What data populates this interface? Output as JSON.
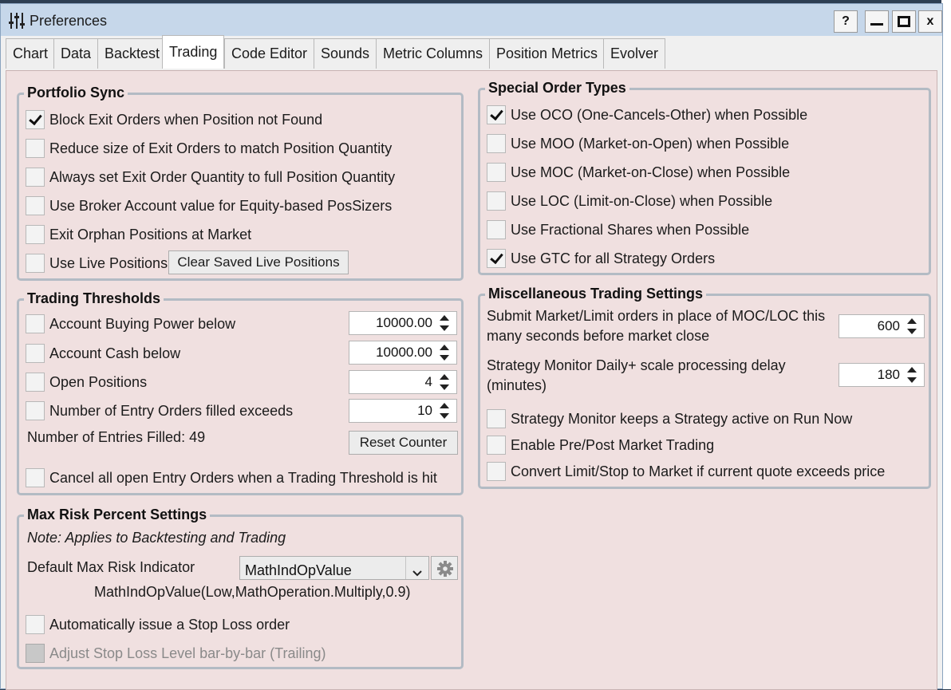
{
  "window": {
    "title": "Preferences",
    "help_label": "?",
    "minimize_label": "—",
    "maximize_label": "▣",
    "close_label": "x"
  },
  "tabs": [
    "Chart",
    "Data",
    "Backtest",
    "Trading",
    "Code Editor",
    "Sounds",
    "Metric Columns",
    "Position Metrics",
    "Evolver"
  ],
  "active_tab": "Trading",
  "portfolio_sync": {
    "title": "Portfolio Sync",
    "items": [
      {
        "label": "Block Exit Orders when Position not Found",
        "checked": true
      },
      {
        "label": "Reduce size of Exit Orders to match Position Quantity",
        "checked": false
      },
      {
        "label": "Always set Exit Order Quantity to full Position Quantity",
        "checked": false
      },
      {
        "label": "Use Broker Account value for Equity-based PosSizers",
        "checked": false
      },
      {
        "label": "Exit Orphan Positions at Market",
        "checked": false
      },
      {
        "label": "Use Live Positions",
        "checked": false
      }
    ],
    "clear_button": "Clear Saved Live Positions"
  },
  "trading_thresholds": {
    "title": "Trading Thresholds",
    "items": [
      {
        "label": "Account Buying Power below",
        "checked": false,
        "value": "10000.00"
      },
      {
        "label": "Account Cash below",
        "checked": false,
        "value": "10000.00"
      },
      {
        "label": "Open Positions",
        "checked": false,
        "value": "4"
      },
      {
        "label": "Number of Entry Orders filled exceeds",
        "checked": false,
        "value": "10"
      }
    ],
    "entries_filled": "Number of Entries Filled: 49",
    "reset_button": "Reset Counter",
    "cancel_label": "Cancel all open Entry Orders when a Trading Threshold is hit",
    "cancel_checked": false
  },
  "max_risk": {
    "title": "Max Risk Percent Settings",
    "note": "Note: Applies to Backtesting and Trading",
    "indicator_label": "Default Max Risk Indicator",
    "indicator_value": "MathIndOpValue",
    "indicator_expr": "MathIndOpValue(Low,MathOperation.Multiply,0.9)",
    "stop_loss_label": "Automatically issue a Stop Loss order",
    "stop_loss_checked": false,
    "trailing_label": "Adjust Stop Loss Level bar-by-bar (Trailing)",
    "trailing_checked": false
  },
  "special_orders": {
    "title": "Special Order Types",
    "items": [
      {
        "label": "Use OCO (One-Cancels-Other) when Possible",
        "checked": true
      },
      {
        "label": "Use MOO (Market-on-Open) when Possible",
        "checked": false
      },
      {
        "label": "Use MOC (Market-on-Close) when Possible",
        "checked": false
      },
      {
        "label": "Use LOC (Limit-on-Close) when Possible",
        "checked": false
      },
      {
        "label": "Use Fractional Shares when Possible",
        "checked": false
      },
      {
        "label": "Use GTC for all Strategy Orders",
        "checked": true
      }
    ]
  },
  "misc": {
    "title": "Miscellaneous Trading Settings",
    "submit_line1": "Submit Market/Limit orders in place of MOC/LOC this",
    "submit_line2": "many seconds before market close",
    "submit_value": "600",
    "delay_line1": "Strategy Monitor Daily+ scale processing delay",
    "delay_line2": "(minutes)",
    "delay_value": "180",
    "items": [
      {
        "label": "Strategy Monitor keeps a Strategy active on Run Now",
        "checked": false
      },
      {
        "label": "Enable Pre/Post Market Trading",
        "checked": false
      },
      {
        "label": "Convert Limit/Stop to Market if current quote exceeds price",
        "checked": false
      }
    ]
  },
  "colors": {
    "panel_bg": "#f0e0e0",
    "title_bar": "#c6d7ea",
    "group_border": "#b3bbc4"
  }
}
